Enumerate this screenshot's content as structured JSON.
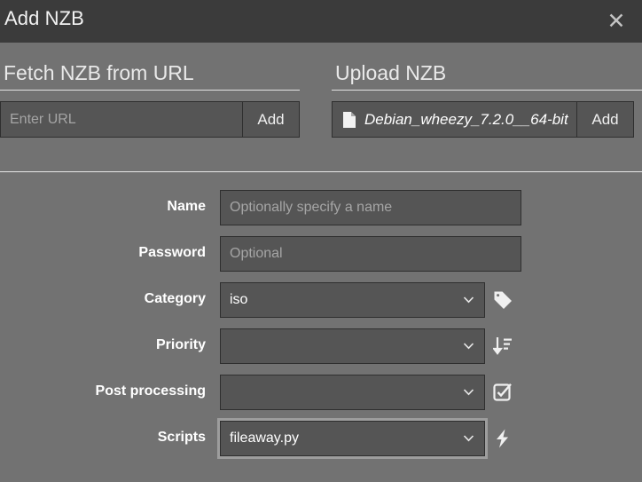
{
  "window": {
    "title": "Add NZB",
    "close_icon": "close-icon"
  },
  "fetch_section": {
    "heading": "Fetch NZB from URL",
    "url_input_placeholder": "Enter URL",
    "url_input_value": "",
    "add_label": "Add"
  },
  "upload_section": {
    "heading": "Upload NZB",
    "file_icon": "file-icon",
    "file_name": "Debian_wheezy_7.2.0__64-bit",
    "add_label": "Add"
  },
  "form": {
    "rows": [
      {
        "label": "Name",
        "type": "text",
        "value": "",
        "placeholder": "Optionally specify a name",
        "icon": ""
      },
      {
        "label": "Password",
        "type": "text",
        "value": "",
        "placeholder": "Optional",
        "icon": ""
      },
      {
        "label": "Category",
        "type": "select",
        "value": "iso",
        "icon": "tag-icon",
        "focused": false
      },
      {
        "label": "Priority",
        "type": "select",
        "value": "",
        "icon": "sort-amount-down-icon",
        "focused": false
      },
      {
        "label": "Post processing",
        "type": "select",
        "value": "",
        "icon": "check-square-icon",
        "focused": false
      },
      {
        "label": "Scripts",
        "type": "select",
        "value": "fileaway.py",
        "icon": "bolt-icon",
        "focused": true
      }
    ]
  },
  "colors": {
    "header_bg": "#3b3b3b",
    "body_bg": "#727272",
    "field_bg": "#555555",
    "field_border": "#2f2f2f",
    "text": "#ffffff",
    "placeholder": "#a5a5a5",
    "rule": "#e6e6e6",
    "focus_ring": "#9d9d9d"
  }
}
